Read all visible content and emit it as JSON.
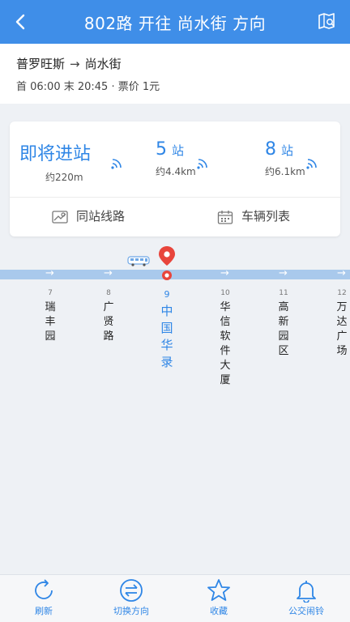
{
  "header": {
    "title": "802路 开往 尚水街 方向"
  },
  "route": {
    "start": "普罗旺斯",
    "arrow": "→",
    "end": "尚水街",
    "schedule": "首 06:00 末 20:45 · 票价 1元"
  },
  "arrivals": [
    {
      "main": "即将进站",
      "distance": "约220m"
    },
    {
      "number": "5",
      "unit": "站",
      "distance": "约4.4km"
    },
    {
      "number": "8",
      "unit": "站",
      "distance": "约6.1km"
    }
  ],
  "actions": {
    "same_station": "同站线路",
    "vehicle_list": "车辆列表"
  },
  "stations": [
    {
      "num": "7",
      "name": [
        "瑞",
        "丰",
        "园"
      ]
    },
    {
      "num": "8",
      "name": [
        "广",
        "贤",
        "路"
      ]
    },
    {
      "num": "9",
      "name": [
        "中",
        "国",
        "华",
        "录"
      ],
      "active": true
    },
    {
      "num": "10",
      "name": [
        "华",
        "信",
        "软",
        "件",
        "大",
        "厦"
      ]
    },
    {
      "num": "11",
      "name": [
        "高",
        "新",
        "园",
        "区"
      ]
    },
    {
      "num": "12",
      "name": [
        "万",
        "达",
        "广",
        "场"
      ]
    }
  ],
  "tabs": [
    {
      "label": "刷新",
      "icon": "refresh-icon"
    },
    {
      "label": "切换方向",
      "icon": "switch-direction-icon"
    },
    {
      "label": "收藏",
      "icon": "star-icon"
    },
    {
      "label": "公交闹铃",
      "icon": "bell-icon"
    }
  ],
  "colors": {
    "primary": "#3f8ee8",
    "accent": "#2f86e6",
    "track": "#a9c9ec",
    "pin": "#e8453c"
  }
}
